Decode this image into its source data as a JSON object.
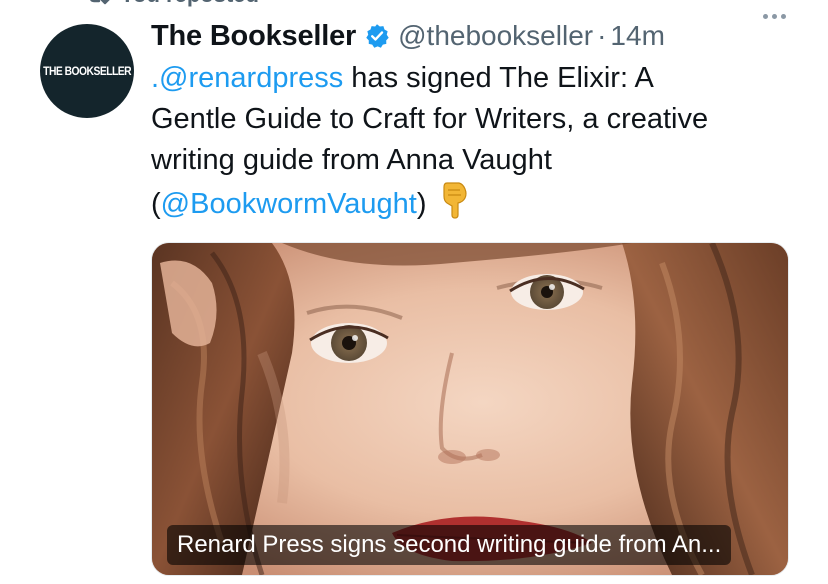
{
  "social_context": {
    "text": "You reposted",
    "icon": "repost-icon"
  },
  "author": {
    "display_name": "The Bookseller",
    "handle": "@thebookseller",
    "separator": "·",
    "timestamp": "14m",
    "verified": true,
    "avatar_text": "THE BOOKSELLER",
    "avatar_bg": "#14252c"
  },
  "tweet": {
    "line1_mention": ".@renardpress",
    "line1_rest": " has signed The Elixir: A",
    "line2": "Gentle Guide to Craft for Writers, a creative",
    "line3": "writing guide from Anna Vaught",
    "line4_open": "(",
    "line4_mention": "@BookwormVaught",
    "line4_close": ")",
    "emoji": "backhand-index-pointing-down"
  },
  "media": {
    "caption": "Renard Press signs second writing guide from An..."
  },
  "colors": {
    "link": "#1d9bf0",
    "text": "#0f1419",
    "muted": "#536471",
    "verified": "#1d9bf0"
  }
}
